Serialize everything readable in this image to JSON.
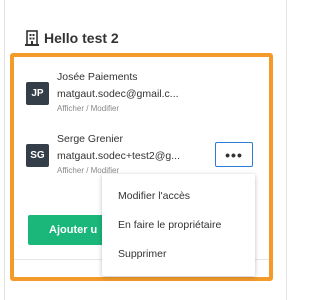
{
  "header": {
    "title": "Hello test 2"
  },
  "members": [
    {
      "initials": "JP",
      "name": "Josée Paiements",
      "email": "matgaut.sodec@gmail.c...",
      "role": "Afficher / Modifier"
    },
    {
      "initials": "SG",
      "name": "Serge Grenier",
      "email": "matgaut.sodec+test2@g...",
      "role": "Afficher / Modifier"
    }
  ],
  "more_button": {
    "label": "•••"
  },
  "add_button": {
    "label": "Ajouter u"
  },
  "menu": {
    "items": [
      "Modifier l'accès",
      "En faire le propriétaire",
      "Supprimer"
    ]
  },
  "colors": {
    "highlight": "#f39a2b",
    "avatar_bg": "#333e48",
    "add_button_bg": "#1bb67a",
    "focus_border": "#2d7bd6"
  },
  "icons": {
    "header": "building-icon"
  }
}
